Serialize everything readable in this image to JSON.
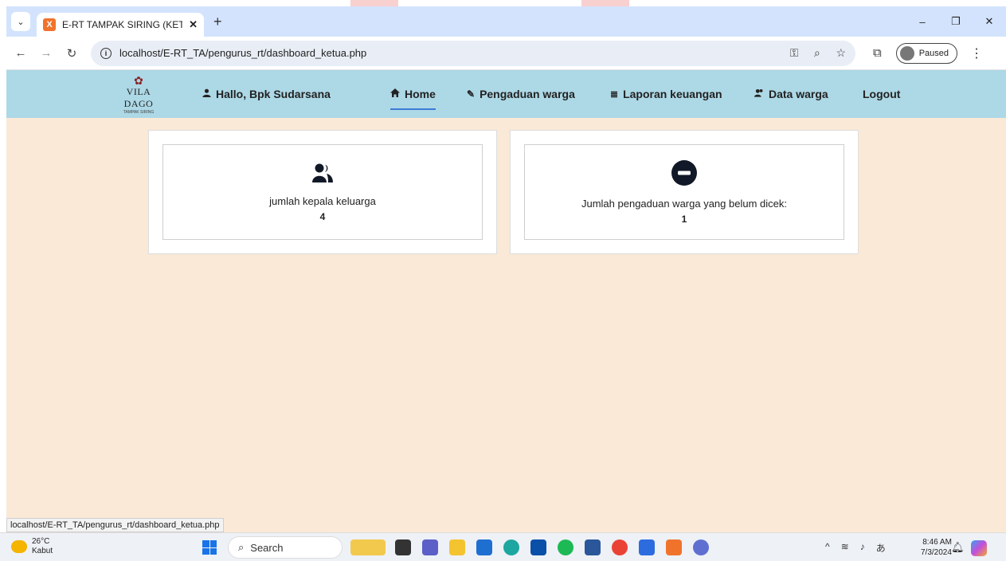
{
  "browser": {
    "tab_title": "E-RT TAMPAK SIRING (KETUA R",
    "tab_close": "✕",
    "new_tab": "+",
    "url": "localhost/E-RT_TA/pengurus_rt/dashboard_ketua.php",
    "profile_label": "Paused",
    "window_controls": [
      "–",
      "❐",
      "✕"
    ]
  },
  "navbar": {
    "logo_text": "VILA DAGO",
    "logo_sub": "TAMPAK SIRING",
    "greeting": "Hallo, Bpk Sudarsana",
    "items": [
      {
        "label": "Home",
        "icon": "home-icon"
      },
      {
        "label": "Pengaduan warga",
        "icon": "edit-icon"
      },
      {
        "label": "Laporan keuangan",
        "icon": "database-icon"
      },
      {
        "label": "Data warga",
        "icon": "users-icon"
      },
      {
        "label": "Logout"
      }
    ]
  },
  "cards": [
    {
      "label": "jumlah kepala keluarga",
      "value": "4",
      "icon": "users-icon"
    },
    {
      "label": "Jumlah pengaduan warga yang belum dicek:",
      "value": "1",
      "icon": "minus-circle-icon"
    }
  ],
  "status_url": "localhost/E-RT_TA/pengurus_rt/dashboard_ketua.php",
  "taskbar": {
    "weather_temp": "26°C",
    "weather_desc": "Kabut",
    "search_placeholder": "Search",
    "time": "8:46 AM",
    "date": "7/3/2024"
  },
  "colors": {
    "navbar": "#add8e6",
    "page_bg": "#fae9d7",
    "active_underline": "#3d7bd6"
  }
}
